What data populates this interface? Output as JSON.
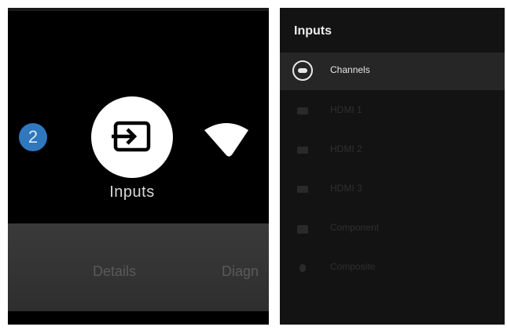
{
  "left": {
    "badge_number": "2",
    "focused_label": "Inputs",
    "bottom_items": [
      "Details",
      "Diagn"
    ]
  },
  "right": {
    "title": "Inputs",
    "items": [
      {
        "label": "Channels",
        "icon": "channels-icon",
        "state": "selected"
      },
      {
        "label": "HDMI 1",
        "icon": "hdmi-icon",
        "state": "dim"
      },
      {
        "label": "HDMI 2",
        "icon": "hdmi-icon",
        "state": "dim"
      },
      {
        "label": "HDMI 3",
        "icon": "hdmi-icon",
        "state": "dim"
      },
      {
        "label": "Component",
        "icon": "component-icon",
        "state": "dim"
      },
      {
        "label": "Composite",
        "icon": "composite-icon",
        "state": "dim"
      }
    ]
  },
  "colors": {
    "badge": "#2f78bd",
    "panel_bg": "#131313",
    "selected_row": "#262626"
  }
}
